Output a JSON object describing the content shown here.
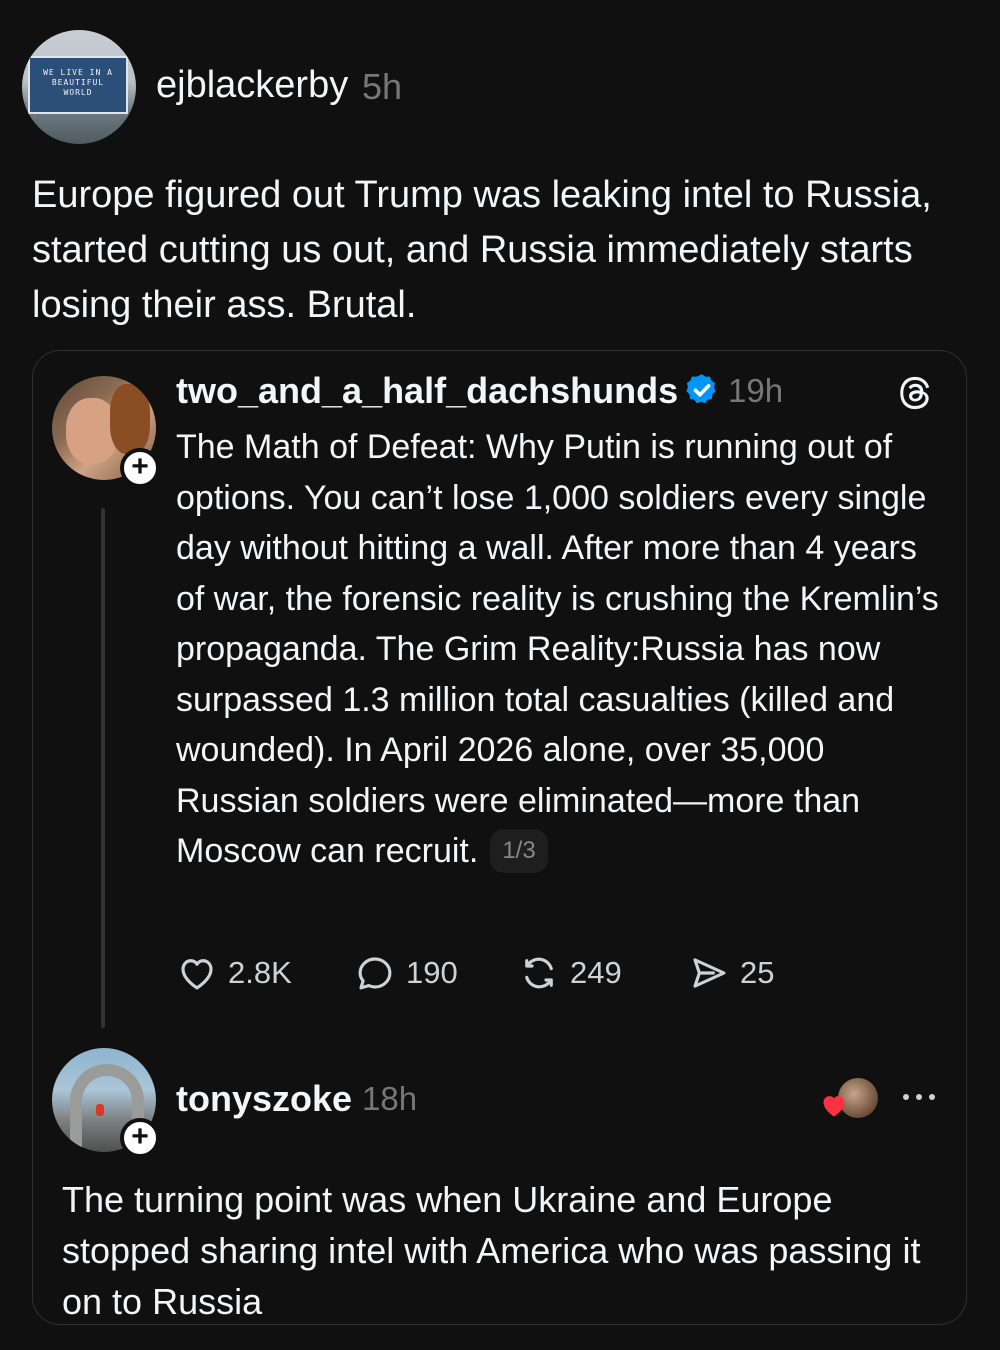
{
  "post": {
    "username": "ejblackerby",
    "time": "5h",
    "text": "Europe figured out Trump was leaking intel to Russia, started cutting us out, and Russia immediately starts losing their ass. Brutal.",
    "avatar_mural": [
      "WE LIVE IN A",
      "BEAUTIFUL",
      "WORLD"
    ]
  },
  "quoted": {
    "username": "two_and_a_half_dachshunds",
    "time": "19h",
    "text": "The Math of Defeat: Why Putin is running out of options. You can’t lose 1,000 soldiers every single day without hitting a wall. After more than 4 years of war, the forensic reality is crushing the Kremlin’s propaganda. The Grim Reality:Russia has now surpassed 1.3 million total casualties (killed and wounded). In April 2026 alone, over 35,000 Russian soldiers were eliminated—more than Moscow can recruit.",
    "pager": "1/3",
    "actions": {
      "likes": "2.8K",
      "replies": "190",
      "reposts": "249",
      "shares": "25"
    },
    "follow_symbol": "+"
  },
  "reply": {
    "username": "tonyszoke",
    "time": "18h",
    "text": "The turning point was when Ukraine and Europe stopped sharing intel with America who was passing it on to Russia",
    "follow_symbol": "+"
  },
  "icons": {
    "verified": "verified-badge-icon",
    "threads": "threads-logo-icon",
    "like": "heart-icon",
    "reply": "comment-icon",
    "repost": "repost-icon",
    "share": "send-icon",
    "more": "more-icon"
  },
  "colors": {
    "background": "#101010",
    "text": "#f3f5f7",
    "muted": "#777777",
    "verified": "#0095f6",
    "heart": "#ff3040"
  }
}
